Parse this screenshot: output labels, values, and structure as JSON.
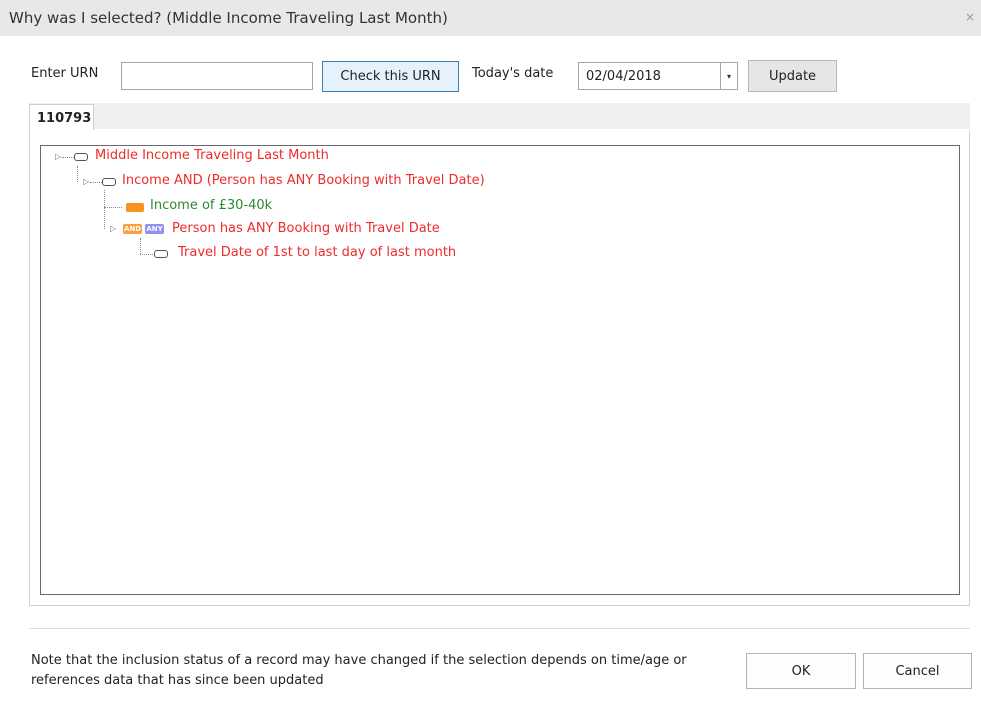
{
  "window": {
    "title": "Why was I selected? (Middle Income Traveling Last Month)",
    "close_glyph": "×"
  },
  "form": {
    "urn_label": "Enter URN",
    "urn_value": "",
    "check_button": "Check this URN",
    "date_label": "Today's date",
    "date_value": "02/04/2018",
    "update_button": "Update"
  },
  "tabs": [
    {
      "label": "110793",
      "active": true
    }
  ],
  "tree": {
    "nodes": [
      {
        "label": "Middle Income Traveling Last Month",
        "status": "red",
        "icon": "condition-icon"
      },
      {
        "label": "Income AND (Person has ANY Booking with Travel Date)",
        "status": "red",
        "icon": "condition-icon"
      },
      {
        "label": "Income of £30-40k",
        "status": "green",
        "icon": "filled-condition-icon"
      },
      {
        "label": "Person has ANY Booking with Travel Date",
        "status": "red",
        "icon": "and-any-icon",
        "badges": [
          "AND",
          "ANY"
        ]
      },
      {
        "label": "Travel Date of 1st to last day of last month",
        "status": "red",
        "icon": "condition-icon"
      }
    ]
  },
  "footer": {
    "note": "Note that the inclusion status of a record may have changed if the selection depends on time/age or references data that has since been updated",
    "ok_button": "OK",
    "cancel_button": "Cancel"
  },
  "colors": {
    "fail": "#ee2b2b",
    "pass": "#2f8a2f",
    "orange": "#f7931e",
    "any_badge": "#8f8ff4"
  }
}
